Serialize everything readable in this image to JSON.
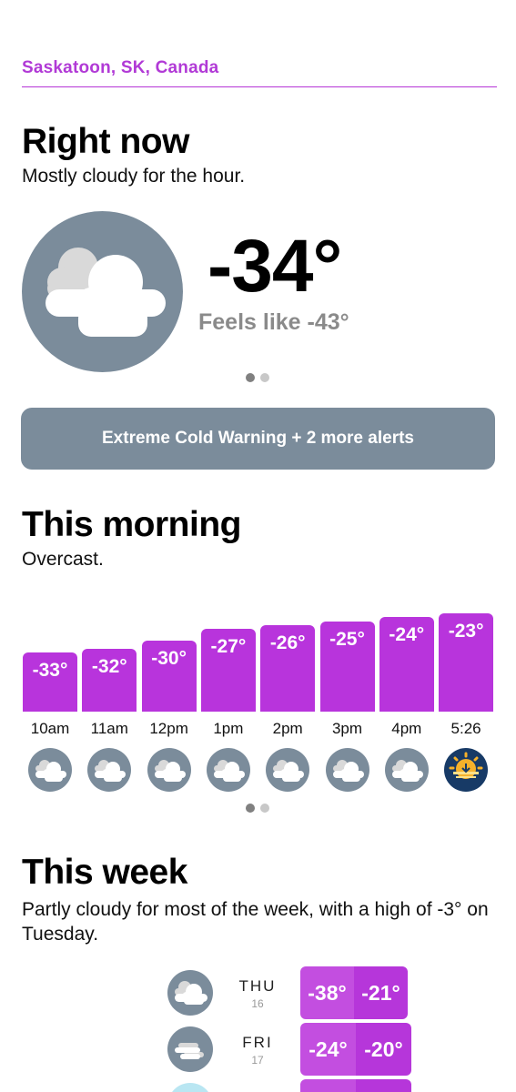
{
  "location": "Saskatoon, SK, Canada",
  "now": {
    "heading": "Right now",
    "summary": "Mostly cloudy for the hour.",
    "temp": "-34°",
    "feels_like": "Feels like -43°",
    "icon": "mostly-cloudy-icon"
  },
  "alert_label": "Extreme Cold Warning + 2 more alerts",
  "morning": {
    "heading": "This morning",
    "summary": "Overcast.",
    "hours": [
      {
        "time": "10am",
        "temp": "-33°",
        "value": -33,
        "icon": "cloudy-icon"
      },
      {
        "time": "11am",
        "temp": "-32°",
        "value": -32,
        "icon": "cloudy-icon"
      },
      {
        "time": "12pm",
        "temp": "-30°",
        "value": -30,
        "icon": "cloudy-icon"
      },
      {
        "time": "1pm",
        "temp": "-27°",
        "value": -27,
        "icon": "cloudy-icon"
      },
      {
        "time": "2pm",
        "temp": "-26°",
        "value": -26,
        "icon": "cloudy-icon"
      },
      {
        "time": "3pm",
        "temp": "-25°",
        "value": -25,
        "icon": "cloudy-icon"
      },
      {
        "time": "4pm",
        "temp": "-24°",
        "value": -24,
        "icon": "cloudy-icon"
      },
      {
        "time": "5:26",
        "temp": "-23°",
        "value": -23,
        "icon": "sunset-icon"
      }
    ]
  },
  "week": {
    "heading": "This week",
    "summary": "Partly cloudy for most of the week, with a high of -3° on Tuesday.",
    "days": [
      {
        "day": "THU",
        "date": "16",
        "low": "-38°",
        "high": "-21°",
        "icon": "cloudy-icon"
      },
      {
        "day": "FRI",
        "date": "17",
        "low": "-24°",
        "high": "-20°",
        "icon": "cloudy-windy-icon"
      },
      {
        "day": "",
        "date": "",
        "low": "",
        "high": "",
        "icon": "partly-cloudy-icon"
      }
    ]
  },
  "colors": {
    "accent": "#b834dc",
    "slate": "#7b8c9b"
  }
}
